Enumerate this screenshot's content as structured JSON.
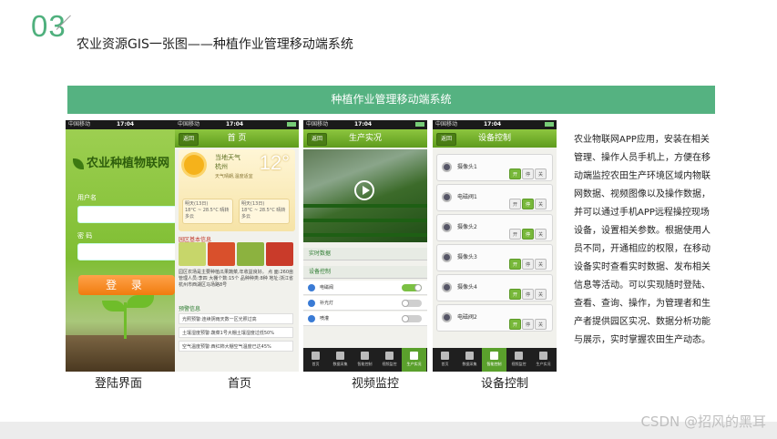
{
  "header": {
    "number": "03",
    "title": "农业资源GIS一张图——种植作业管理移动端系统"
  },
  "banner": {
    "title": "种植作业管理移动端系统"
  },
  "status_bar": {
    "carrier": "中国移动",
    "time": "17:04"
  },
  "phones": {
    "login": {
      "logo_text": "农业种植物联网",
      "username_label": "用户名",
      "password_label": "密 码",
      "login_button": "登 录",
      "caption": "登陆界面"
    },
    "home": {
      "back": "返回",
      "title": "首 页",
      "weather_label": "当地天气",
      "city": "杭州",
      "temperature": "12°",
      "weather_desc": "天气晴朗,温度适宜",
      "forecast_1": "明天(13日)",
      "forecast_1_detail": "18°C ~ 28.5°C 晴转多云",
      "forecast_2": "明天(13日)",
      "forecast_2_detail": "18°C ~ 28.5°C 晴转多云",
      "farm_heading": "园区基本信息",
      "farm_text": "园区农场是主要种植瓜果蔬菜,年收益良好。 点  面:260亩   管理人员:李四 大棚个数:15个   品种种类:8种 地址:浙江省杭州市西湖区马场路8号",
      "alarm_heading": "预警信息",
      "alarms": [
        "光照预警:连续阴雨天数一区光照过高",
        "土壤湿度预警:蔬菜1号大棚土壤湿度过低50%",
        "空气温度预警:西红柿大棚空气温度已达45%"
      ],
      "caption": "首页"
    },
    "video": {
      "back": "返回",
      "title": "生产实况",
      "realtime_label": "实时数据",
      "device_label": "设备控制",
      "rows": [
        "电磁阀",
        "补光灯",
        "喷灌"
      ],
      "caption": "视频监控"
    },
    "control": {
      "back": "返回",
      "title": "设备控制",
      "devices": [
        "摄像头1",
        "电磁阀1",
        "摄像头2",
        "摄像头3",
        "摄像头4",
        "电磁阀2"
      ],
      "btn_on": "开",
      "btn_stop": "停",
      "btn_off": "关",
      "caption": "设备控制"
    }
  },
  "tabbar": [
    "首页",
    "数据采集",
    "智能控制",
    "视频监控",
    "生产实况"
  ],
  "description": "农业物联网APP应用，安装在相关管理、操作人员手机上，方便在移动端监控农田生产环境区域内物联网数据、视频图像以及操作数据，并可以通过手机APP远程操控现场设备，设置相关参数。根据使用人员不同，开通相应的权限，在移动设备实时查看实时数据、发布相关信息等活动。可以实现随时登陆、查看、查询、操作，为管理者和生产者提供园区实况、数据分析功能与展示，实时掌握农田生产动态。",
  "watermark": "CSDN @招风的黑耳"
}
